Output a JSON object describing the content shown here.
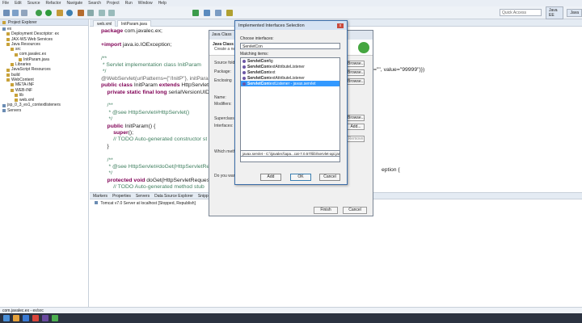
{
  "menu": [
    "File",
    "Edit",
    "Source",
    "Refactor",
    "Navigate",
    "Search",
    "Project",
    "Run",
    "Window",
    "Help"
  ],
  "quick_access": "Quick Access",
  "perspectives": [
    "Java EE",
    "Java"
  ],
  "explorer": {
    "title": "Project Explorer",
    "items": [
      {
        "label": "ex",
        "indent": 0
      },
      {
        "label": "Deployment Descriptor: ex",
        "indent": 1
      },
      {
        "label": "JAX-WS Web Services",
        "indent": 1
      },
      {
        "label": "Java Resources",
        "indent": 1
      },
      {
        "label": "src",
        "indent": 2
      },
      {
        "label": "com.javalec.ex",
        "indent": 3
      },
      {
        "label": "InitParam.java",
        "indent": 4
      },
      {
        "label": "Libraries",
        "indent": 2
      },
      {
        "label": "JavaScript Resources",
        "indent": 1
      },
      {
        "label": "build",
        "indent": 1
      },
      {
        "label": "WebContent",
        "indent": 1
      },
      {
        "label": "META-INF",
        "indent": 2
      },
      {
        "label": "WEB-INF",
        "indent": 2
      },
      {
        "label": "lib",
        "indent": 3
      },
      {
        "label": "web.xml",
        "indent": 3
      },
      {
        "label": "jsp_0_3_ex1_contextlisteners",
        "indent": 0
      },
      {
        "label": "Servers",
        "indent": 0
      }
    ]
  },
  "editor": {
    "tabs": [
      "web.xml",
      "InitParam.java"
    ],
    "lines": [
      [
        {
          "t": "package ",
          "c": "kw"
        },
        {
          "t": "com.javalec.ex;",
          "c": ""
        }
      ],
      [],
      [
        {
          "t": "+import ",
          "c": "kw"
        },
        {
          "t": "java.io.IOException;",
          "c": ""
        }
      ],
      [],
      [
        {
          "t": "/**",
          "c": "cm"
        }
      ],
      [
        {
          "t": " * Servlet implementation class InitParam",
          "c": "cm"
        }
      ],
      [
        {
          "t": " */",
          "c": "cm"
        }
      ],
      [
        {
          "t": "@WebServlet(urlPatterns={\"/InitP\"}, initParams=",
          "c": "an"
        }
      ],
      [
        {
          "t": "public class ",
          "c": "kw"
        },
        {
          "t": "InitParam ",
          "c": ""
        },
        {
          "t": "extends ",
          "c": "kw"
        },
        {
          "t": "HttpServlet {",
          "c": ""
        }
      ],
      [
        {
          "t": "    private static final long ",
          "c": "kw"
        },
        {
          "t": "serialVersionUID",
          "c": ""
        }
      ],
      [],
      [
        {
          "t": "    /**",
          "c": "cm"
        }
      ],
      [
        {
          "t": "     * @see HttpServlet#HttpServlet()",
          "c": "cm"
        }
      ],
      [
        {
          "t": "     */",
          "c": "cm"
        }
      ],
      [
        {
          "t": "    public ",
          "c": "kw"
        },
        {
          "t": "InitParam() {",
          "c": ""
        }
      ],
      [
        {
          "t": "        super",
          "c": "kw"
        },
        {
          "t": "();",
          "c": ""
        }
      ],
      [
        {
          "t": "        // TODO Auto-generated constructor st",
          "c": "cm"
        }
      ],
      [
        {
          "t": "    }",
          "c": ""
        }
      ],
      [],
      [
        {
          "t": "    /**",
          "c": "cm"
        }
      ],
      [
        {
          "t": "     * @see HttpServlet#doGet(HttpServletRequest",
          "c": "cm"
        }
      ],
      [
        {
          "t": "     */",
          "c": "cm"
        }
      ],
      [
        {
          "t": "    protected void ",
          "c": "kw"
        },
        {
          "t": "doGet(HttpServletRequest r",
          "c": ""
        }
      ],
      [
        {
          "t": "        // TODO Auto-generated method stub",
          "c": "cm"
        }
      ]
    ],
    "right_fragment_1": "=\"\", value=\"99999\")})",
    "right_fragment_2": "eption {"
  },
  "wizard": {
    "title": "Java Class",
    "header": "Java Class",
    "subheader": "Create a ne",
    "labels": {
      "source_folder": "Source folde",
      "package": "Package:",
      "enclosing": "Enclosing",
      "name": "Name:",
      "modifiers": "Modifiers:",
      "superclass": "Superclass:",
      "interfaces": "Interfaces:",
      "which_method": "Which meth",
      "do_you_want": "Do you wan"
    },
    "buttons": {
      "browse": "Browse...",
      "add": "Add...",
      "remove": "Remove",
      "finish": "Finish",
      "cancel": "Cancel"
    }
  },
  "dialog": {
    "title": "Implemented Interfaces Selection",
    "close": "x",
    "choose_label": "Choose interfaces:",
    "search_value": "ServletCon",
    "matching_label": "Matching items:",
    "items": [
      {
        "bold": "ServletCon",
        "rest": "fig",
        "selected": false
      },
      {
        "bold": "ServletCon",
        "rest": "textAttributeListener",
        "selected": false
      },
      {
        "bold": "ServletCon",
        "rest": "text",
        "selected": false
      },
      {
        "bold": "ServletCon",
        "rest": "textAttributeListener",
        "selected": false
      },
      {
        "bold": "ServletCon",
        "rest": "textListener - javax.servlet",
        "selected": true
      }
    ],
    "qualifier": "javax.servlet - C:\\\\javalec\\\\apa...cat-7.0.57\\\\lib\\\\servlet-api.jar",
    "buttons": {
      "add": "Add",
      "ok": "OK",
      "cancel": "Cancel"
    }
  },
  "bottom": {
    "tabs": [
      "Markers",
      "Properties",
      "Servers",
      "Data Source Explorer",
      "Snippets"
    ],
    "server": "Tomcat v7.0 Server at localhost [Stopped, Republish]"
  },
  "status": "com.javalec.ex - ex/src",
  "colors": {
    "keyword": "#7f0055",
    "comment": "#3f7f5f",
    "selection": "#3399ff",
    "dialog_border": "#3c6ea9"
  }
}
